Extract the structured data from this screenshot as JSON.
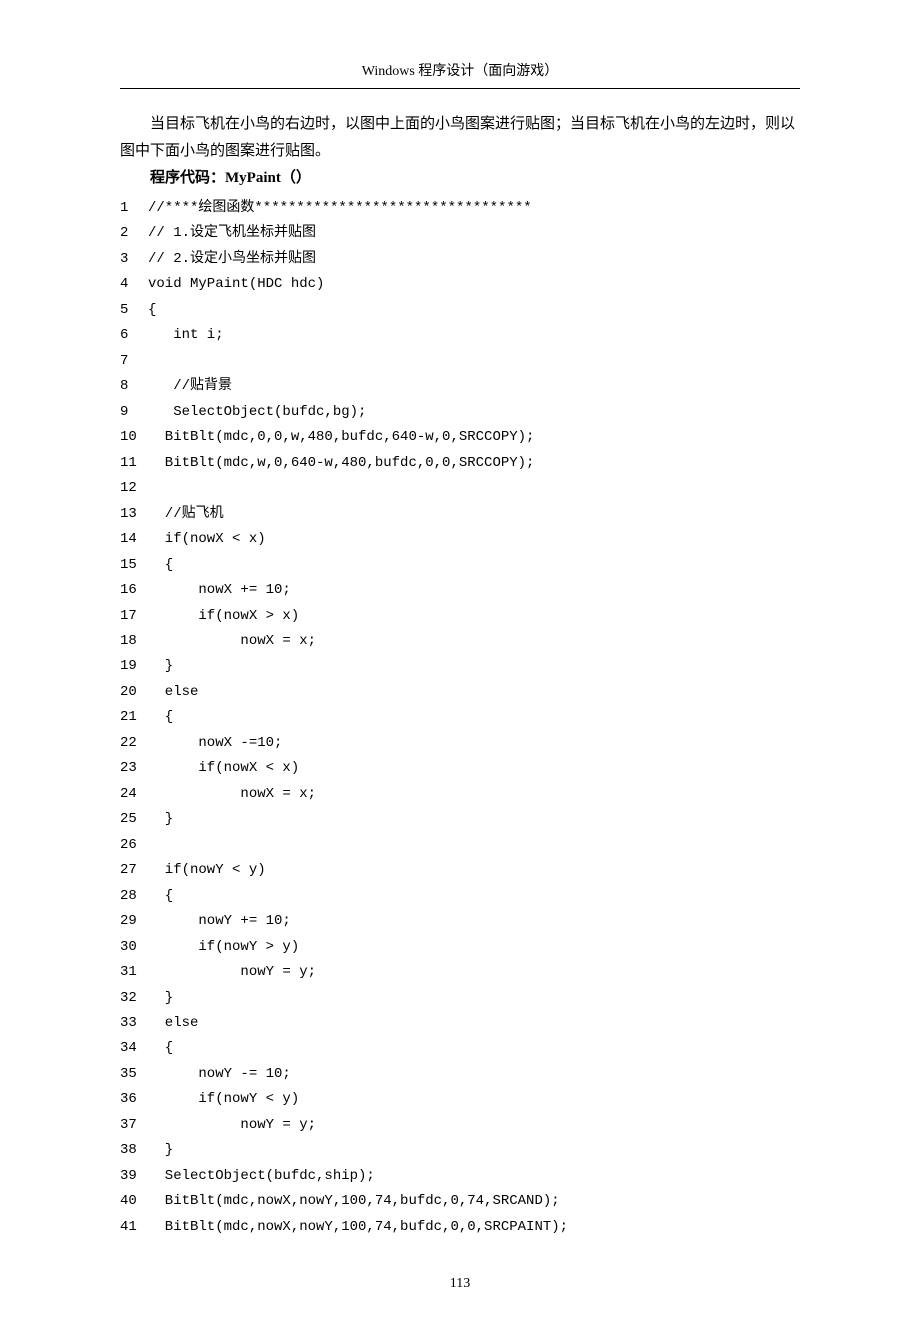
{
  "header": "Windows 程序设计（面向游戏）",
  "para1": "当目标飞机在小鸟的右边时，以图中上面的小鸟图案进行贴图；当目标飞机在小鸟的左边时，则以图中下面小鸟的图案进行贴图。",
  "code_label": "程序代码：MyPaint（）",
  "code_lines": [
    {
      "n": "1",
      "t": "//****绘图函数*********************************"
    },
    {
      "n": "2",
      "t": "// 1.设定飞机坐标并贴图"
    },
    {
      "n": "3",
      "t": "// 2.设定小鸟坐标并贴图"
    },
    {
      "n": "4",
      "t": "void MyPaint(HDC hdc)"
    },
    {
      "n": "5",
      "t": "{"
    },
    {
      "n": "6",
      "t": "   int i;"
    },
    {
      "n": "7",
      "t": ""
    },
    {
      "n": "8",
      "t": "   //贴背景"
    },
    {
      "n": "9",
      "t": "   SelectObject(bufdc,bg);"
    },
    {
      "n": "10",
      "t": "  BitBlt(mdc,0,0,w,480,bufdc,640-w,0,SRCCOPY);"
    },
    {
      "n": "11",
      "t": "  BitBlt(mdc,w,0,640-w,480,bufdc,0,0,SRCCOPY);"
    },
    {
      "n": "12",
      "t": ""
    },
    {
      "n": "13",
      "t": "  //贴飞机"
    },
    {
      "n": "14",
      "t": "  if(nowX < x)"
    },
    {
      "n": "15",
      "t": "  {"
    },
    {
      "n": "16",
      "t": "      nowX += 10;"
    },
    {
      "n": "17",
      "t": "      if(nowX > x)"
    },
    {
      "n": "18",
      "t": "           nowX = x;"
    },
    {
      "n": "19",
      "t": "  }"
    },
    {
      "n": "20",
      "t": "  else"
    },
    {
      "n": "21",
      "t": "  {"
    },
    {
      "n": "22",
      "t": "      nowX -=10;"
    },
    {
      "n": "23",
      "t": "      if(nowX < x)"
    },
    {
      "n": "24",
      "t": "           nowX = x;"
    },
    {
      "n": "25",
      "t": "  }"
    },
    {
      "n": "26",
      "t": ""
    },
    {
      "n": "27",
      "t": "  if(nowY < y)"
    },
    {
      "n": "28",
      "t": "  {"
    },
    {
      "n": "29",
      "t": "      nowY += 10;"
    },
    {
      "n": "30",
      "t": "      if(nowY > y)"
    },
    {
      "n": "31",
      "t": "           nowY = y;"
    },
    {
      "n": "32",
      "t": "  }"
    },
    {
      "n": "33",
      "t": "  else"
    },
    {
      "n": "34",
      "t": "  {"
    },
    {
      "n": "35",
      "t": "      nowY -= 10;"
    },
    {
      "n": "36",
      "t": "      if(nowY < y)"
    },
    {
      "n": "37",
      "t": "           nowY = y;"
    },
    {
      "n": "38",
      "t": "  }"
    },
    {
      "n": "39",
      "t": "  SelectObject(bufdc,ship);"
    },
    {
      "n": "40",
      "t": "  BitBlt(mdc,nowX,nowY,100,74,bufdc,0,74,SRCAND);"
    },
    {
      "n": "41",
      "t": "  BitBlt(mdc,nowX,nowY,100,74,bufdc,0,0,SRCPAINT);"
    }
  ],
  "page_number": "113"
}
